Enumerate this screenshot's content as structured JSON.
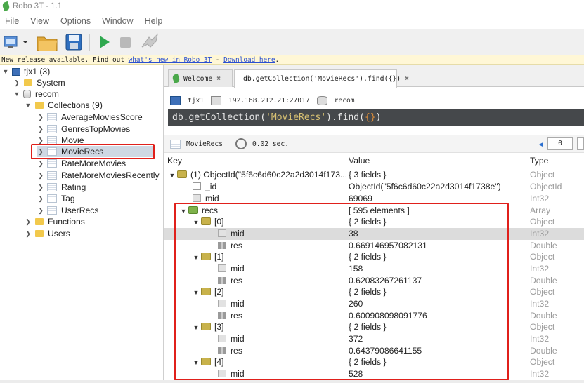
{
  "window": {
    "title": "Robo 3T - 1.1"
  },
  "menu": [
    "File",
    "View",
    "Options",
    "Window",
    "Help"
  ],
  "notice": {
    "prefix": "New release available. Find out ",
    "link1": "what's new in Robo 3T",
    "sep": " - ",
    "link2": "Download here",
    "suffix": "."
  },
  "sidebar": {
    "server": "tjx1 (3)",
    "system": "System",
    "db": "recom",
    "collections": "Collections (9)",
    "items": [
      "AverageMoviesScore",
      "GenresTopMovies",
      "Movie",
      "MovieRecs",
      "RateMoreMovies",
      "RateMoreMoviesRecently",
      "Rating",
      "Tag",
      "UserRecs"
    ],
    "functions": "Functions",
    "users": "Users"
  },
  "tabs": {
    "welcome": "Welcome",
    "query": "db.getCollection('MovieRecs').find({})"
  },
  "conn": {
    "server": "tjx1",
    "address": "192.168.212.21:27017",
    "db": "recom"
  },
  "query": {
    "pre": "db.getCollection(",
    "str": "'MovieRecs'",
    "post": ").find(",
    "args": "{}",
    "end": ")"
  },
  "result": {
    "collection": "MovieRecs",
    "time": "0.02 sec.",
    "page": "0"
  },
  "columns": {
    "key": "Key",
    "value": "Value",
    "type": "Type"
  },
  "rows": [
    {
      "key": "(1) ObjectId(\"5f6c6d60c22a2d3014f173...",
      "value": "{ 3 fields }",
      "type": "Object"
    },
    {
      "key": "_id",
      "value": "ObjectId(\"5f6c6d60c22a2d3014f1738e\")",
      "type": "ObjectId"
    },
    {
      "key": "mid",
      "value": "69069",
      "type": "Int32"
    },
    {
      "key": "recs",
      "value": "[ 595 elements ]",
      "type": "Array"
    },
    {
      "key": "[0]",
      "value": "{ 2 fields }",
      "type": "Object"
    },
    {
      "key": "mid",
      "value": "38",
      "type": "Int32"
    },
    {
      "key": "res",
      "value": "0.669146957082131",
      "type": "Double"
    },
    {
      "key": "[1]",
      "value": "{ 2 fields }",
      "type": "Object"
    },
    {
      "key": "mid",
      "value": "158",
      "type": "Int32"
    },
    {
      "key": "res",
      "value": "0.62083267261137",
      "type": "Double"
    },
    {
      "key": "[2]",
      "value": "{ 2 fields }",
      "type": "Object"
    },
    {
      "key": "mid",
      "value": "260",
      "type": "Int32"
    },
    {
      "key": "res",
      "value": "0.600908098091776",
      "type": "Double"
    },
    {
      "key": "[3]",
      "value": "{ 2 fields }",
      "type": "Object"
    },
    {
      "key": "mid",
      "value": "372",
      "type": "Int32"
    },
    {
      "key": "res",
      "value": "0.64379086641155",
      "type": "Double"
    },
    {
      "key": "[4]",
      "value": "{ 2 fields }",
      "type": "Object"
    },
    {
      "key": "mid",
      "value": "528",
      "type": "Int32"
    }
  ]
}
